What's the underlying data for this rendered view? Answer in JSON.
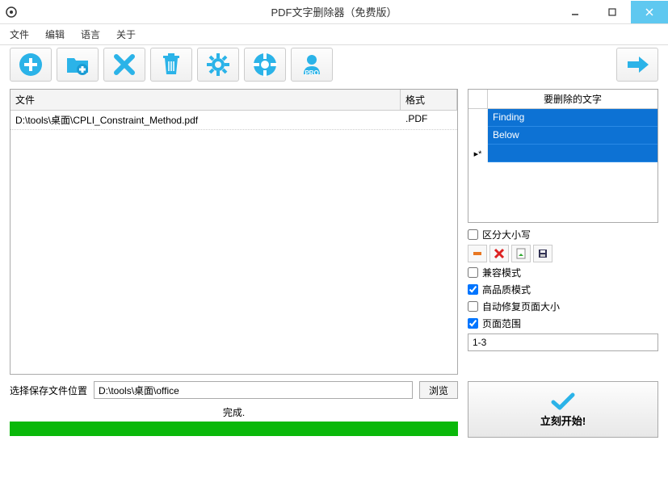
{
  "window": {
    "title": "PDF文字删除器（免费版）"
  },
  "menu": {
    "file": "文件",
    "edit": "编辑",
    "language": "语言",
    "about": "关于"
  },
  "table": {
    "headers": {
      "file": "文件",
      "format": "格式"
    },
    "rows": [
      {
        "file": "D:\\tools\\桌面\\CPLI_Constraint_Method.pdf",
        "format": ".PDF"
      }
    ]
  },
  "words": {
    "header": "要删除的文字",
    "items": [
      "Finding",
      "Below"
    ],
    "new_marker": "▸*"
  },
  "options": {
    "case_sensitive": "区分大小写",
    "compat_mode": "兼容模式",
    "hq_mode": "高品质模式",
    "auto_fix_size": "自动修复页面大小",
    "page_range": "页面范围",
    "page_range_value": "1-3"
  },
  "save": {
    "label": "选择保存文件位置",
    "path": "D:\\tools\\桌面\\office",
    "browse": "浏览"
  },
  "status": {
    "text": "完成."
  },
  "start": {
    "label": "立刻开始!"
  }
}
